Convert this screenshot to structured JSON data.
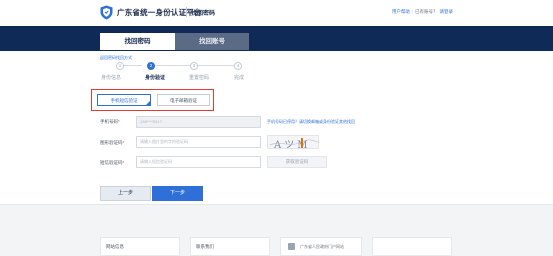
{
  "header": {
    "brand": "广东省统一身份认证平台",
    "subtitle": "找回密码",
    "links": [
      {
        "label": "用户帮助",
        "type": "link"
      },
      {
        "label": "已有账号？",
        "type": "text"
      },
      {
        "label": "请登录",
        "type": "link"
      }
    ]
  },
  "tabs": [
    {
      "label": "找回密码",
      "active": true
    },
    {
      "label": "找回账号",
      "active": false
    }
  ],
  "breadcrumb": "返回密码找回方式",
  "steps": [
    {
      "number": "1",
      "label": "身份信息",
      "active": false
    },
    {
      "number": "2",
      "label": "身份验证",
      "active": true
    },
    {
      "number": "3",
      "label": "重置密码",
      "active": false
    },
    {
      "number": "4",
      "label": "完成",
      "active": false
    }
  ],
  "verify_modes": {
    "phone": "手机短信验证",
    "email": "电子邮箱验证"
  },
  "form": {
    "phone_label": "手机号码",
    "phone_value": "138****5317",
    "phone_help": "手机号码已停用？请切换邮箱或身份验证其他找回",
    "captcha_label": "图形验证码",
    "captcha_placeholder": "请输入图片里的字符验证码",
    "captcha_text": "AツM",
    "sms_label": "短信验证码",
    "sms_placeholder": "请输入短信验证码",
    "sms_button": "获取验证码",
    "required_mark": "*"
  },
  "actions": {
    "prev": "上一步",
    "next": "下一步"
  },
  "footer": {
    "col1": "网站信息",
    "col2": "联系我们",
    "note": "广东省人民政府门户网站"
  },
  "colors": {
    "navy": "#0f2a56",
    "accent": "#2f6fd8",
    "highlight": "#e53935"
  }
}
